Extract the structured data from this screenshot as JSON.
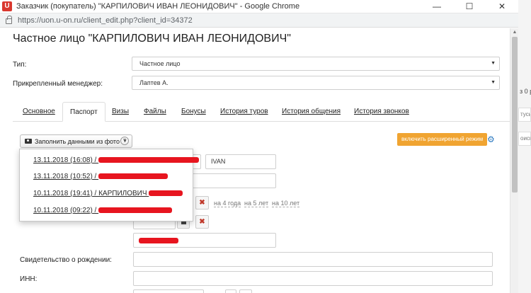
{
  "window": {
    "app_icon": "U",
    "title": "Заказчик (покупатель) \"КАРПИЛОВИЧ ИВАН ЛЕОНИДОВИЧ\" - Google Chrome",
    "minimize": "—",
    "maximize": "☐",
    "close": "✕",
    "url": "https://uon.u-on.ru/client_edit.php?client_id=34372"
  },
  "page": {
    "title": "Частное лицо \"КАРПИЛОВИЧ ИВАН ЛЕОНИДОВИЧ\"",
    "type_label": "Тип:",
    "type_value": "Частное лицо",
    "manager_label": "Прикрепленный менеджер:",
    "manager_value": "Лаптев А."
  },
  "tabs": [
    {
      "label": "Основное"
    },
    {
      "label": "Паспорт"
    },
    {
      "label": "Визы"
    },
    {
      "label": "Файлы"
    },
    {
      "label": "Бонусы"
    },
    {
      "label": "История туров"
    },
    {
      "label": "История общения"
    },
    {
      "label": "История звонков"
    }
  ],
  "passport": {
    "fill_button": "Заполнить данными из фото",
    "help": "?",
    "extended_mode": "включить расширенный режим",
    "name_latin": "IVAN",
    "clear": "✖",
    "quick_periods": [
      "на 4 года",
      "на 5 лет",
      "на 10 лет"
    ],
    "birth_cert_label": "Свидетельство о рождении:",
    "inn_label": "ИНН:"
  },
  "photo_menu": {
    "items": [
      {
        "label": "13.11.2018 (16:08) / "
      },
      {
        "label": "13.11.2018 (10:52) / "
      },
      {
        "label": "10.11.2018 (19:41) / КАРПИЛОВИЧ "
      },
      {
        "label": "10.11.2018 (09:22) / "
      }
    ]
  },
  "background_page": {
    "text_1": "з 0 р",
    "text_2": "тусы",
    "text_3": "оиск"
  },
  "colors": {
    "accent_orange": "#f0a431",
    "redaction": "#e7151f",
    "link_blue": "#2b78c0"
  }
}
